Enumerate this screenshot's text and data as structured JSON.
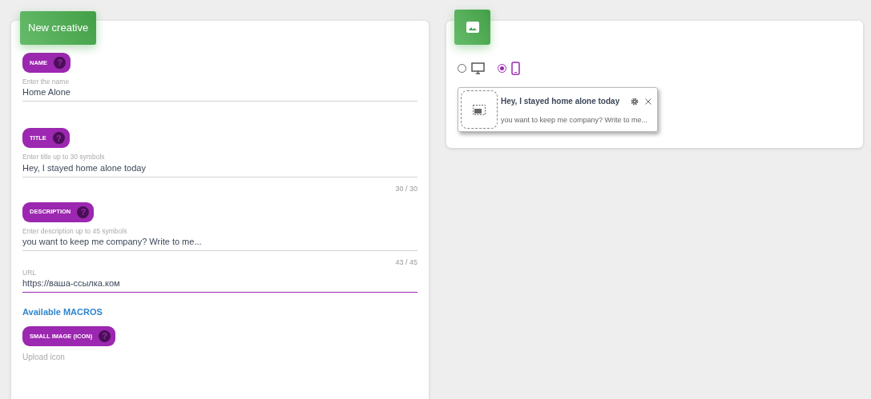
{
  "form": {
    "title": "New creative",
    "fields": [
      {
        "kind": "pill",
        "label": "NAME",
        "help": "?",
        "hint": "Enter the name",
        "value": "Home Alone",
        "focused": false
      },
      {
        "kind": "pill",
        "label": "TITLE",
        "help": "?",
        "hint": "Enter title up to 30 symbols",
        "value": "Hey, I stayed home alone today",
        "focused": false,
        "counter": "30 / 30"
      },
      {
        "kind": "pill",
        "label": "DESCRIPTION",
        "help": "?",
        "hint": "Enter description up to 45 symbols",
        "value": "you want to keep me company? Write to me...",
        "focused": false,
        "counter": "43 / 45"
      },
      {
        "kind": "plain",
        "hint": "URL",
        "value": "https://ваша-ссылка.ком",
        "focused": true
      }
    ],
    "macros_link": "Available MACROS",
    "icon_section": {
      "label": "SMALL IMAGE (ICON)",
      "help": "?",
      "hint": "Upload icon"
    }
  },
  "preview": {
    "devices": [
      {
        "kind": "desktop",
        "selected": false
      },
      {
        "kind": "mobile",
        "selected": true
      }
    ],
    "notification": {
      "title": "Hey, I stayed home alone today",
      "body": "you want to keep me company? Write to me..."
    }
  }
}
